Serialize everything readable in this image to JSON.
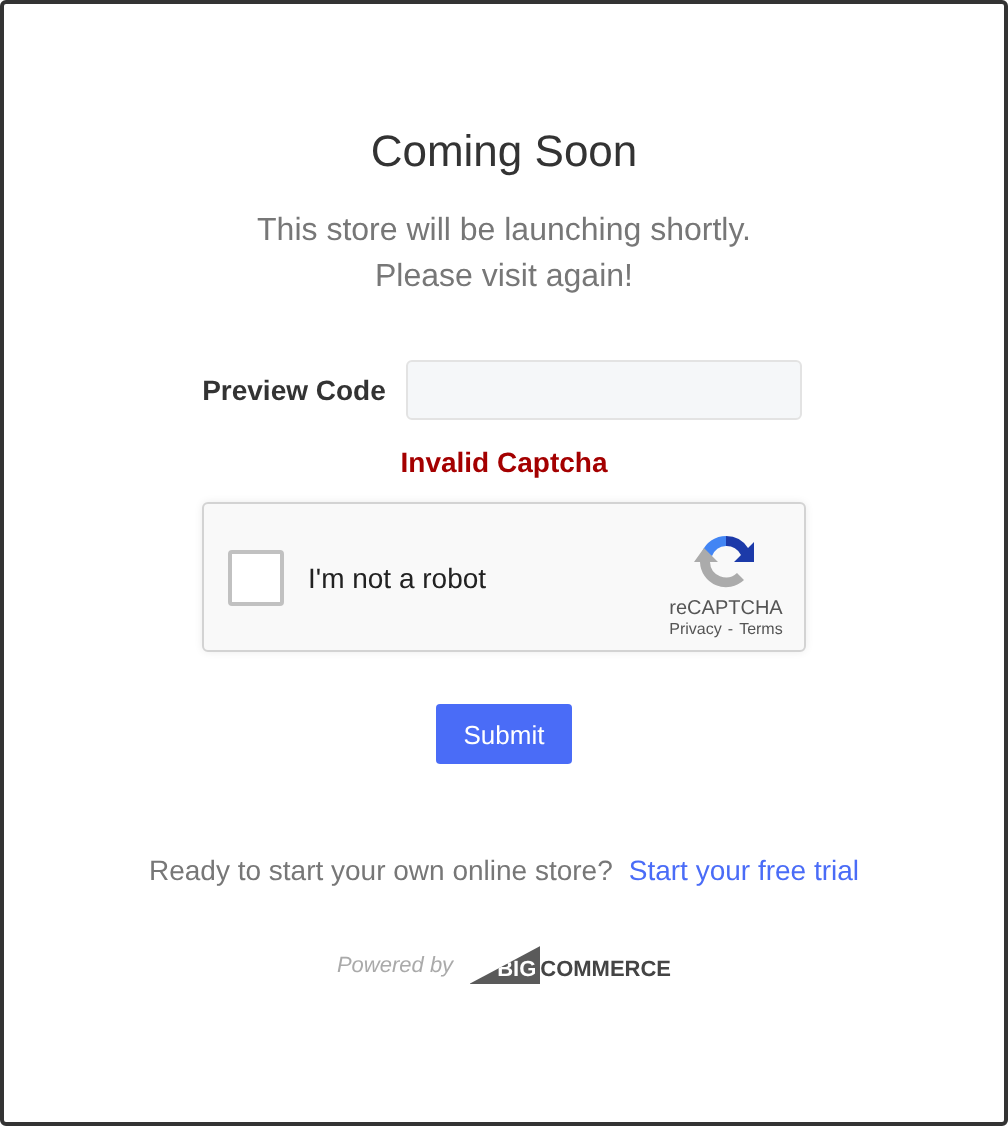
{
  "heading": "Coming Soon",
  "message_lines": [
    "This store will be launching shortly.",
    "Please visit again!"
  ],
  "preview_code": {
    "label": "Preview Code"
  },
  "error": "Invalid Captcha",
  "captcha": {
    "checked": false,
    "label": "I'm not a robot",
    "brand": "reCAPTCHA",
    "privacy": "Privacy",
    "separator": "-",
    "terms": "Terms"
  },
  "submit": "Submit",
  "footer": {
    "prompt": "Ready to start your own online store?",
    "link": "Start your free trial"
  },
  "powered_by": {
    "label": "Powered by",
    "logo_part_1": "BIG",
    "logo_part_2": "COMMERCE"
  }
}
